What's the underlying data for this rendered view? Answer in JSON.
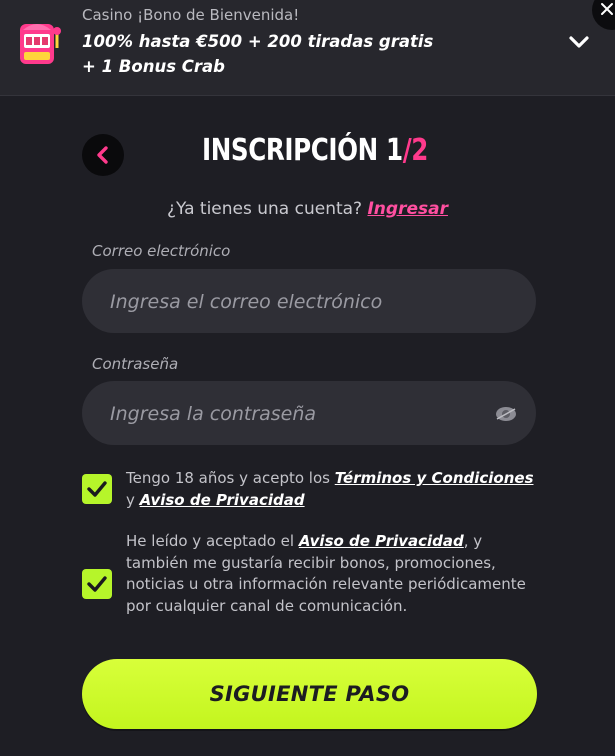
{
  "banner": {
    "small_text": "Casino ¡Bono de Bienvenida!",
    "line1": "100% hasta €500 + 200 tiradas gratis",
    "line2": "+ 1 Bonus Crab",
    "icon": "slot-machine-icon",
    "toggle_icon": "chevron-down-icon"
  },
  "header": {
    "title_main": "INSCRIPCIÓN 1",
    "title_slash": "/",
    "title_total": "2",
    "back_icon": "chevron-left-icon"
  },
  "account": {
    "question": "¿Ya tienes una cuenta?",
    "login_link": "Ingresar"
  },
  "form": {
    "email_label": "Correo electrónico",
    "email_placeholder": "Ingresa el correo electrónico",
    "email_value": "",
    "password_label": "Contraseña",
    "password_placeholder": "Ingresa la contraseña",
    "password_value": ""
  },
  "consents": {
    "terms_prefix": "Tengo 18 años y acepto los",
    "terms_link": "Términos y Condiciones",
    "terms_and": "y",
    "terms_privacy_link": "Aviso de Privacidad",
    "terms_checked": true,
    "marketing_prefix": "He leído y aceptado el",
    "marketing_link": "Aviso de Privacidad",
    "marketing_suffix": ", y también me gustaría recibir bonos, promociones, noticias u otra información relevante periódicamente por cualquier canal de comunicación.",
    "marketing_checked": true
  },
  "cta": {
    "label": "SIGUIENTE PASO"
  },
  "colors": {
    "background": "#1e1e24",
    "accent_pink": "#ff3a8c",
    "accent_lime": "#c3f51e",
    "input_bg": "#2f2f36"
  }
}
